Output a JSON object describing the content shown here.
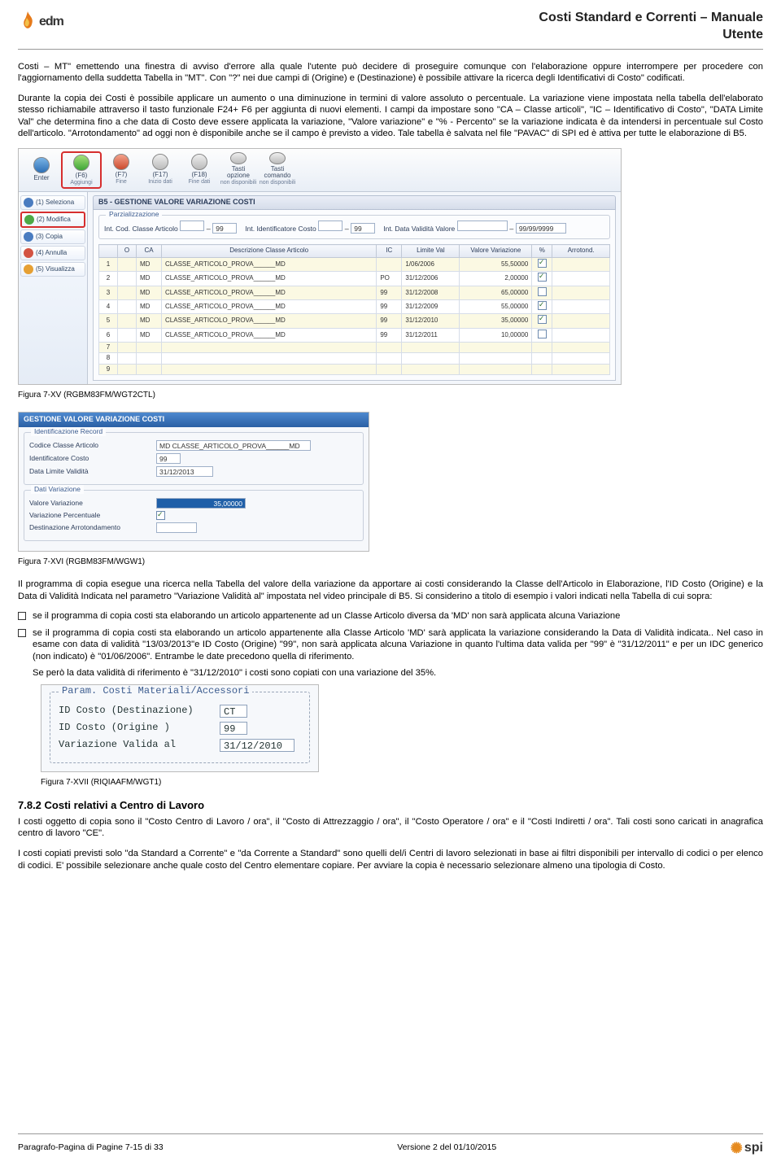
{
  "header": {
    "logo_text": "edm",
    "title_l1": "Costi Standard e Correnti – Manuale",
    "title_l2": "Utente"
  },
  "para1": "Costi – MT\" emettendo una finestra di avviso d'errore alla quale l'utente può decidere di proseguire comunque con l'elaborazione oppure interrompere per procedere con l'aggiornamento della suddetta Tabella in \"MT\".  Con \"?\" nei due campi di (Origine) e (Destinazione) è possibile attivare la ricerca degli Identificativi di Costo\" codificati.",
  "para2": "Durante la copia dei Costi è possibile applicare un aumento o una diminuzione  in termini di valore assoluto o percentuale.  La variazione  viene impostata nella tabella dell'elaborato stesso richiamabile attraverso il tasto funzionale F24+ F6 per aggiunta di nuovi elementi.  I campi da impostare sono  \"CA – Classe articoli\", \"IC – Identificativo di Costo\", \"DATA Limite Val\" che determina fino a che data di Costo deve essere applicata la variazione, \"Valore variazione\"  e  \"% - Percento\" se la variazione indicata è da intendersi in percentuale sul Costo dell'articolo.   \"Arrotondamento\" ad oggi non è disponibile anche se il campo è previsto a video.    Tale tabella è salvata nel file \"PAVAC\" di SPI ed è attiva per tutte le elaborazione di B5.",
  "shot1": {
    "toolbar": [
      {
        "label": "Enter",
        "sub": "",
        "ic": "enter"
      },
      {
        "label": "(F6)",
        "sub": "Aggiungi",
        "ic": "green",
        "sel": true
      },
      {
        "label": "(F7)",
        "sub": "Fine",
        "ic": "red"
      },
      {
        "label": "(F17)",
        "sub": "Inizio dati",
        "ic": "gray"
      },
      {
        "label": "(F18)",
        "sub": "Fine dati",
        "ic": "gray"
      },
      {
        "label": "Tasti opzione",
        "sub": "non disponibili",
        "ic": "gray"
      },
      {
        "label": "Tasti comando",
        "sub": "non disponibili",
        "ic": "gray"
      }
    ],
    "side": [
      {
        "n": "(1) Seleziona",
        "c": "b"
      },
      {
        "n": "(2) Modifica",
        "c": "g",
        "act": true
      },
      {
        "n": "(3) Copia",
        "c": "b"
      },
      {
        "n": "(4) Annulla",
        "c": "r"
      },
      {
        "n": "(5) Visualizza",
        "c": "o"
      }
    ],
    "tab_title": "B5 - GESTIONE VALORE VARIAZIONE COSTI",
    "parz_legend": "Parzializzazione",
    "parz": {
      "l1": "Int. Cod. Classe Articolo",
      "v1a": "",
      "v1b": "99",
      "l2": "Int. Identificatore Costo",
      "v2a": "",
      "v2b": "99",
      "l3": "Int. Data Validità Valore",
      "v3a": "",
      "v3b": "99/99/9999"
    },
    "cols": [
      "",
      "O",
      "CA",
      "Descrizione Classe Articolo",
      "IC",
      "Limite Val",
      "Valore Variazione",
      "%",
      "Arrotond."
    ],
    "rows": [
      {
        "n": "1",
        "ca": "MD",
        "desc": "CLASSE_ARTICOLO_PROVA______MD",
        "ic": "",
        "dt": "1/06/2006",
        "val": "55,50000",
        "pc": true
      },
      {
        "n": "2",
        "ca": "MD",
        "desc": "CLASSE_ARTICOLO_PROVA______MD",
        "ic": "PO",
        "dt": "31/12/2006",
        "val": "2,00000",
        "pc": true
      },
      {
        "n": "3",
        "ca": "MD",
        "desc": "CLASSE_ARTICOLO_PROVA______MD",
        "ic": "99",
        "dt": "31/12/2008",
        "val": "65,00000",
        "pc": false
      },
      {
        "n": "4",
        "ca": "MD",
        "desc": "CLASSE_ARTICOLO_PROVA______MD",
        "ic": "99",
        "dt": "31/12/2009",
        "val": "55,00000",
        "pc": true
      },
      {
        "n": "5",
        "ca": "MD",
        "desc": "CLASSE_ARTICOLO_PROVA______MD",
        "ic": "99",
        "dt": "31/12/2010",
        "val": "35,00000",
        "pc": true
      },
      {
        "n": "6",
        "ca": "MD",
        "desc": "CLASSE_ARTICOLO_PROVA______MD",
        "ic": "99",
        "dt": "31/12/2011",
        "val": "10,00000",
        "pc": false
      },
      {
        "n": "7",
        "ca": "",
        "desc": "",
        "ic": "",
        "dt": "",
        "val": "",
        "pc": null
      },
      {
        "n": "8",
        "ca": "",
        "desc": "",
        "ic": "",
        "dt": "",
        "val": "",
        "pc": null
      },
      {
        "n": "9",
        "ca": "",
        "desc": "",
        "ic": "",
        "dt": "",
        "val": "",
        "pc": null
      }
    ]
  },
  "cap1": "Figura 7-XV  (RGBM83FM/WGT2CTL)",
  "shot2": {
    "title": "GESTIONE VALORE VARIAZIONE COSTI",
    "g1": "Identificazione Record",
    "r1": {
      "l": "Codice Classe Articolo",
      "v": "MD CLASSE_ARTICOLO_PROVA______MD"
    },
    "r2": {
      "l": "Identificatore Costo",
      "v": "99"
    },
    "r3": {
      "l": "Data Limite Validità",
      "v": "31/12/2013"
    },
    "g2": "Dati Variazione",
    "r4": {
      "l": "Valore Variazione",
      "v": "35,00000"
    },
    "r5": {
      "l": "Variazione Percentuale"
    },
    "r6": {
      "l": "Destinazione Arrotondamento",
      "v": ""
    }
  },
  "cap2": "Figura 7-XVI  (RGBM83FM/WGW1)",
  "para3": "Il programma di copia esegue una ricerca nella Tabella del valore della variazione da apportare ai costi considerando la Classe dell'Articolo in Elaborazione, l'ID Costo (Origine) e la Data di Validità Indicata nel parametro \"Variazione Validità al\" impostata nel video principale di B5.    Si considerino a titolo di esempio i valori indicati nella Tabella di cui sopra:",
  "bul1": "se il programma di copia costi sta elaborando un articolo appartenente ad un Classe Articolo diversa da 'MD' non sarà applicata alcuna Variazione",
  "bul2": "se il programma di copia costi sta elaborando un articolo appartenente alla Classe Articolo 'MD' sarà applicata la variazione considerando la Data di Validità indicata.. Nel caso in esame con data di validità \"13/03/2013\"e ID Costo (Origine) \"99\", non sarà applicata alcuna Variazione in quanto l'ultima data valida per \"99\"  è  \"31/12/2011\" e per un IDC generico (non indicato) è \"01/06/2006\".   Entrambe le date precedono quella di riferimento.",
  "bul2b": "Se però la data validità di riferimento è \"31/12/2010\" i costi sono copiati con una variazione del 35%.",
  "shot3": {
    "legend": "Param. Costi Materiali/Accessori",
    "r1": {
      "l": "ID Costo (Destinazione)",
      "v": "CT"
    },
    "r2": {
      "l": "ID Costo (Origine    )",
      "v": "99"
    },
    "r3": {
      "l": "Variazione Valida al",
      "v": "31/12/2010"
    }
  },
  "cap3": "Figura 7-XVII  (RIQIAAFM/WGT1)",
  "sec": "7.8.2  Costi relativi a Centro di Lavoro",
  "para4": "I costi oggetto di copia sono il \"Costo Centro di Lavoro / ora\", il \"Costo di Attrezzaggio / ora\", il \"Costo Operatore / ora\" e il \"Costi Indiretti / ora\".   Tali costi sono caricati in anagrafica centro di lavoro \"CE\".",
  "para5": "I costi copiati previsti solo \"da Standard a Corrente\" e  \"da Corrente a Standard\" sono quelli del/i Centri di lavoro selezionati in base ai filtri disponibili per intervallo di codici  o per elenco di codici.   E' possibile selezionare anche quale costo del Centro elementare copiare. Per avviare la copia è necessario selezionare almeno una tipologia di Costo.",
  "footer": {
    "left": "Paragrafo-Pagina di Pagine 7-15 di 33",
    "mid": "Versione 2 del 01/10/2015",
    "brand": "spi"
  }
}
